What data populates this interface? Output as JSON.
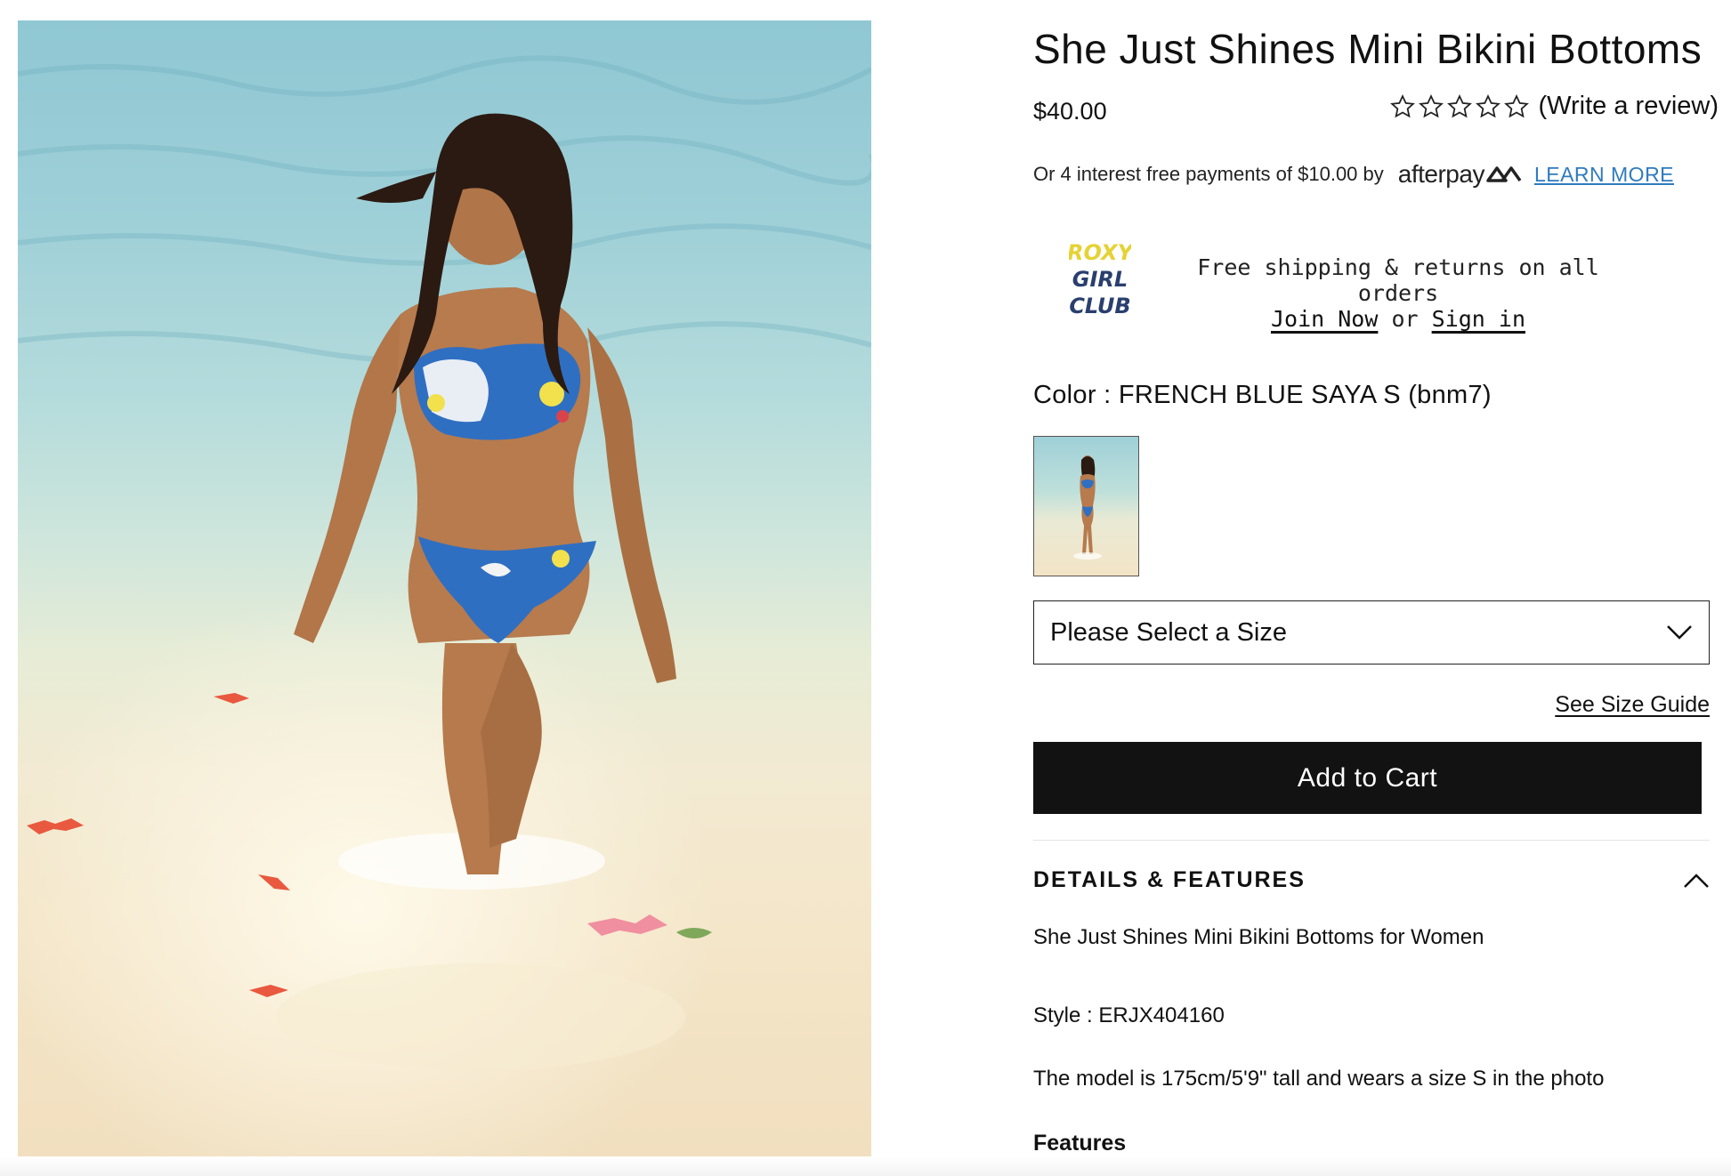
{
  "product": {
    "title": "She Just Shines Mini Bikini Bottoms",
    "price": "$40.00",
    "rating": {
      "stars_filled": 0,
      "stars_total": 5,
      "review_link": "(Write a review)"
    }
  },
  "afterpay": {
    "text": "Or 4 interest free payments of $10.00 by",
    "logo_text": "afterpay",
    "learn_more": "LEARN MORE"
  },
  "club": {
    "logo_alt": "ROXY GIRL CLUB",
    "message": "Free shipping & returns on all orders",
    "join_label": "Join Now",
    "or_label": "or",
    "signin_label": "Sign in",
    "logo_color": "#e6d235",
    "logo_color_secondary": "#2a3f6e"
  },
  "color": {
    "label": "Color : FRENCH BLUE SAYA S (bnm7)"
  },
  "size": {
    "placeholder": "Please Select a Size",
    "guide_label": "See Size Guide"
  },
  "cart": {
    "label": "Add to Cart",
    "color": "#121212"
  },
  "details": {
    "heading": "DETAILS & FEATURES",
    "description": "She Just Shines Mini Bikini Bottoms for Women",
    "style": "Style : ERJX404160",
    "model": "The model is 175cm/5'9\" tall and wears a size S in the photo",
    "features_heading": "Features"
  },
  "colors": {
    "link_blue": "#2f7bbf",
    "bikini_blue": "#2f6fc2"
  }
}
